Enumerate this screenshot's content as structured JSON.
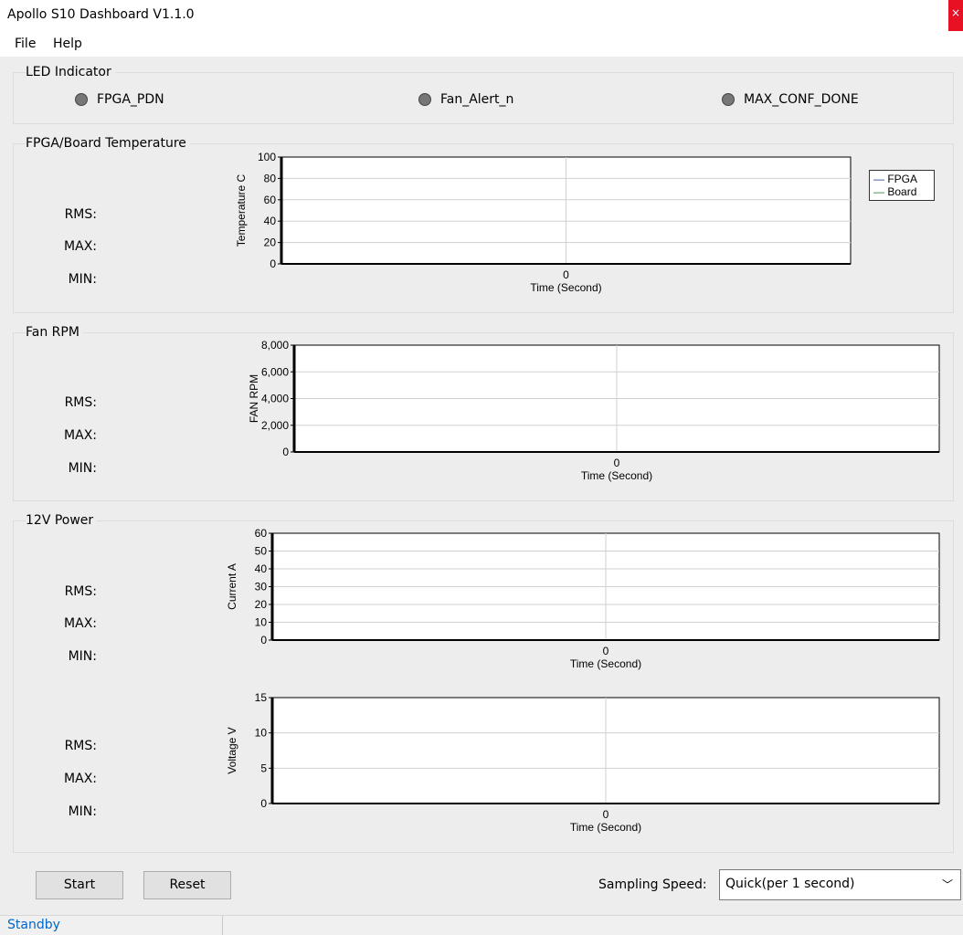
{
  "window": {
    "title": "Apollo S10 Dashboard  V1.1.0",
    "close_icon": "×"
  },
  "menu": {
    "file": "File",
    "help": "Help"
  },
  "led": {
    "title": "LED Indicator",
    "items": [
      "FPGA_PDN",
      "Fan_Alert_n",
      "MAX_CONF_DONE"
    ]
  },
  "stats": {
    "rms": "RMS:",
    "max": "MAX:",
    "min": "MIN:"
  },
  "temperature": {
    "title": "FPGA/Board Temperature"
  },
  "fan": {
    "title": "Fan RPM"
  },
  "power": {
    "title": "12V Power"
  },
  "controls": {
    "start": "Start",
    "reset": "Reset",
    "sampling_label": "Sampling Speed:",
    "sampling_value": "Quick(per 1 second)"
  },
  "status": {
    "text": "Standby"
  },
  "colors": {
    "plot_bg": "#ffffff",
    "grid": "#d0d0d0",
    "axis": "#000000",
    "fpga": "#1f3a93",
    "board": "#2e7d32",
    "status_text": "#0066cc",
    "close_bg": "#e81123"
  },
  "chart_data": [
    {
      "type": "line",
      "ylabel": "Temperature C",
      "xlabel": "Time (Second)",
      "ylim": [
        0,
        100
      ],
      "yticks": [
        "0",
        "20",
        "40",
        "60",
        "80",
        "100"
      ],
      "xticks": [
        "0"
      ],
      "series": [
        {
          "name": "FPGA",
          "values": []
        },
        {
          "name": "Board",
          "values": []
        }
      ],
      "legend": "right"
    },
    {
      "type": "line",
      "ylabel": "FAN RPM",
      "xlabel": "Time (Second)",
      "ylim": [
        0,
        8000
      ],
      "yticks": [
        "0",
        "2,000",
        "4,000",
        "6,000",
        "8,000"
      ],
      "xticks": [
        "0"
      ],
      "series": []
    },
    {
      "type": "line",
      "ylabel": "Current A",
      "xlabel": "Time (Second)",
      "ylim": [
        0,
        60
      ],
      "yticks": [
        "0",
        "10",
        "20",
        "30",
        "40",
        "50",
        "60"
      ],
      "xticks": [
        "0"
      ],
      "series": []
    },
    {
      "type": "line",
      "ylabel": "Voltage V",
      "xlabel": "Time (Second)",
      "ylim": [
        0,
        15
      ],
      "yticks": [
        "0",
        "5",
        "10",
        "15"
      ],
      "xticks": [
        "0"
      ],
      "series": []
    }
  ]
}
